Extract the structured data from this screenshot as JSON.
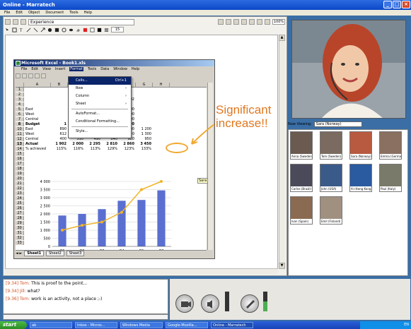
{
  "window": {
    "title": "Online - Marratech"
  },
  "menu": [
    "File",
    "Edit",
    "Object",
    "Document",
    "Tools",
    "Help"
  ],
  "docbar": {
    "document_name": "Experience",
    "zoom": "100%",
    "line_width": "15"
  },
  "excel": {
    "title": "Microsoft Excel - Book1.xls",
    "menu": [
      "File",
      "Edit",
      "View",
      "Insert",
      "Format",
      "Tools",
      "Data",
      "Window",
      "Help"
    ],
    "columns": [
      "A",
      "B",
      "C",
      "D",
      "E",
      "F",
      "G",
      "H"
    ],
    "rows": [
      {
        "n": "1",
        "cells": [
          "",
          "",
          "",
          "",
          "",
          "",
          ""
        ]
      },
      {
        "n": "2",
        "cells": [
          "",
          "",
          "",
          "",
          "",
          "",
          ""
        ]
      },
      {
        "n": "3",
        "cells": [
          "",
          "",
          "",
          "Q4",
          "Q1",
          "Q2",
          ""
        ]
      },
      {
        "n": "4",
        "cells": [
          "",
          "",
          "",
          "",
          "",
          "",
          ""
        ]
      },
      {
        "n": "5",
        "cells": [
          "East",
          "",
          "",
          "925",
          "1000",
          "1200",
          ""
        ]
      },
      {
        "n": "6",
        "cells": [
          "West",
          "",
          "",
          "600",
          "675",
          "700",
          ""
        ]
      },
      {
        "n": "7",
        "cells": [
          "Central",
          "",
          "",
          "650",
          "650",
          "700",
          ""
        ]
      },
      {
        "n": "8",
        "cells": [
          "Budget",
          "1",
          "",
          "2 175",
          "2 325",
          "2 600",
          ""
        ]
      },
      {
        "n": "10",
        "cells": [
          "East",
          "890",
          "930",
          "1 115",
          "1 250",
          "1 200",
          "1 200"
        ]
      },
      {
        "n": "11",
        "cells": [
          "West",
          "612",
          "680",
          "690",
          "720",
          "740",
          "1 300"
        ]
      },
      {
        "n": "12",
        "cells": [
          "Central",
          "400",
          "510",
          "490",
          "840",
          "920",
          "950"
        ]
      },
      {
        "n": "13",
        "cells": [
          "Actual",
          "1 902",
          "2 000",
          "2 295",
          "2 810",
          "2 860",
          "3 450"
        ]
      },
      {
        "n": "14",
        "cells": [
          "% achieved",
          "115%",
          "116%",
          "113%",
          "129%",
          "123%",
          "133%"
        ]
      }
    ],
    "format_menu": [
      "Cells...",
      "Row",
      "Column",
      "Sheet",
      "AutoFormat...",
      "Conditional Formatting...",
      "Style..."
    ],
    "format_shortcut": "Ctrl+1",
    "sheet_tabs": [
      "Sheet1",
      "Sheet2",
      "Sheet3"
    ],
    "note_label": "Sara"
  },
  "chart_data": {
    "type": "bar",
    "categories": [
      "Q1",
      "Q2",
      "Q3",
      "Q4",
      "Q1",
      "Q2"
    ],
    "series": [
      {
        "type": "bar",
        "values": [
          1902,
          2000,
          2295,
          2810,
          2860,
          3450
        ]
      },
      {
        "type": "line",
        "values": [
          1000,
          1300,
          1500,
          2100,
          3500,
          4000
        ]
      }
    ],
    "yticks": [
      "4 000",
      "3 500",
      "3 000",
      "2 500",
      "2 000",
      "1 500",
      "1 000",
      "500",
      "0"
    ],
    "ylim": [
      0,
      4000
    ],
    "grid": true,
    "colors": {
      "bars": "#5a6fd0",
      "line": "#f0b428"
    }
  },
  "annotation": {
    "line1": "Significant",
    "line2": "increase!!"
  },
  "viewing": {
    "label": "Now Viewing:",
    "value": "Sara (Norway)"
  },
  "participants": [
    "Anna (Sweden)",
    "Tom (Sweden)",
    "Sara (Norway)",
    "Emma (Germany)",
    "Carlos (Brazil)",
    "John (USA)",
    "Ai (Hong Kong)",
    "Paul (Italy)",
    "Ivan (Spain)",
    "Emil (Finland)"
  ],
  "chat": [
    {
      "time": "[9.34] Tom:",
      "text": "This is proof to the point..."
    },
    {
      "time": "[9.34] Jill:",
      "text": "what?"
    },
    {
      "time": "[9.36] Tom:",
      "text": "work is an activity, not a place ;-)"
    }
  ],
  "taskbar": {
    "start": "start",
    "tasks": [
      "ab",
      "Inbox - Micros...",
      "Windows Media",
      "Google-Mozilla...",
      "Online - Marratech"
    ],
    "tray": "EN"
  }
}
